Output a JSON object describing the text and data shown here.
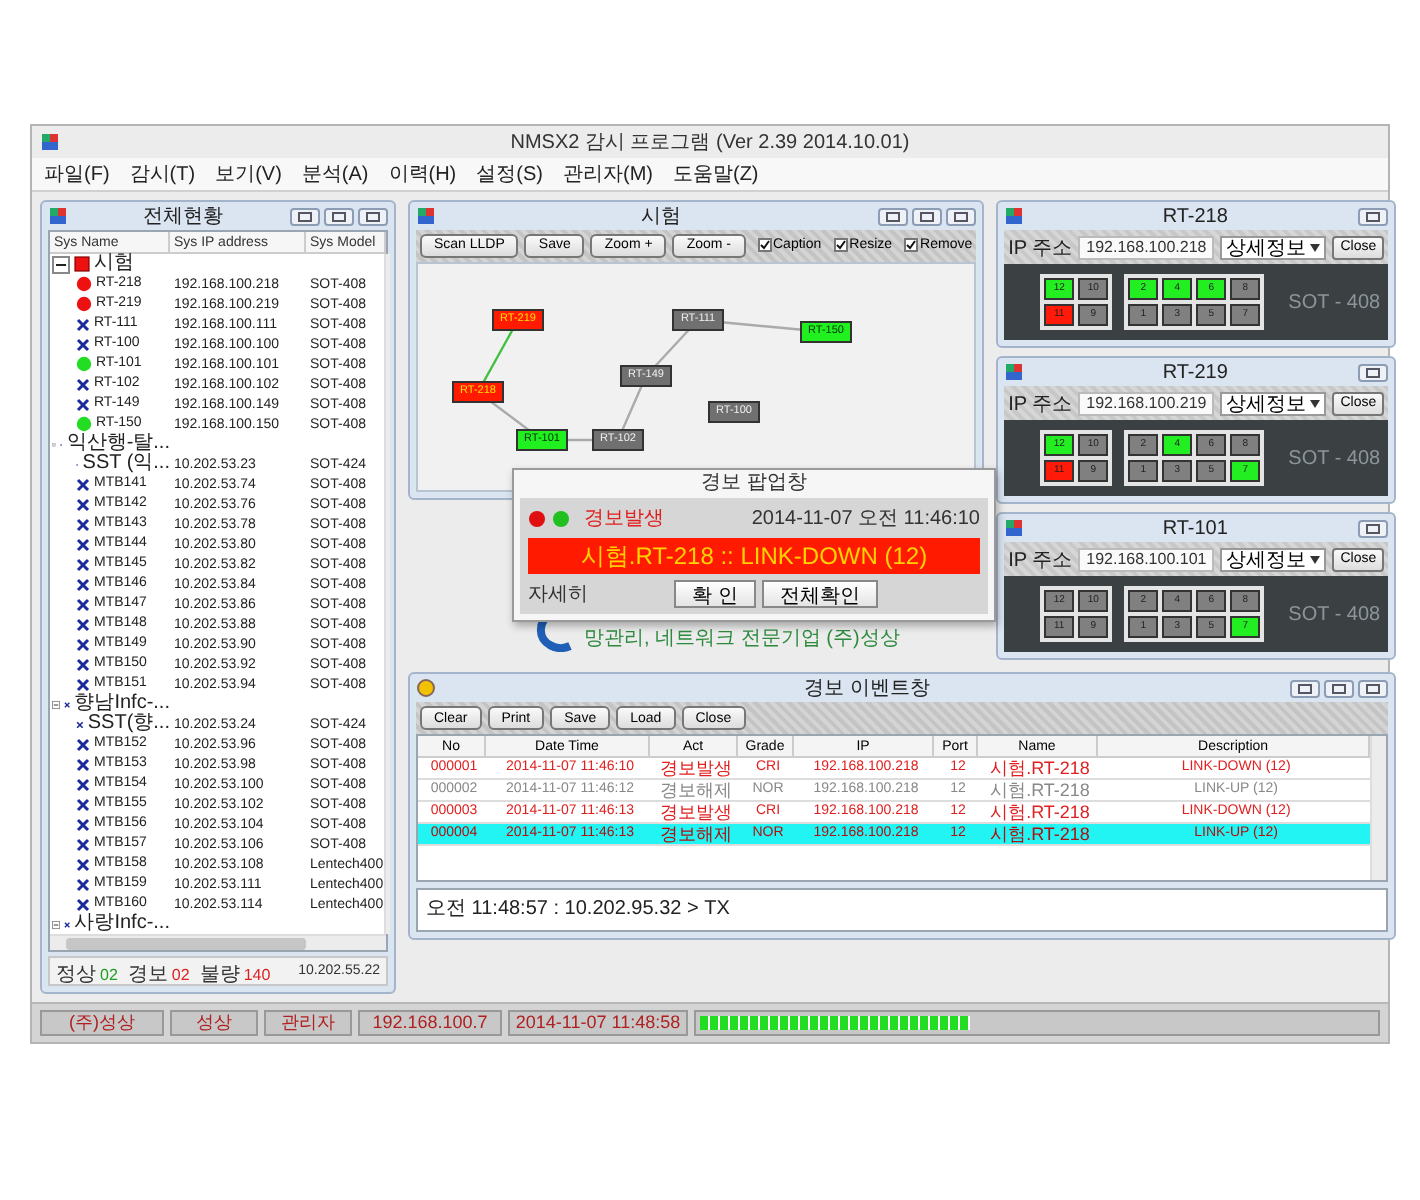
{
  "window": {
    "title": "NMSX2 감시 프로그램 (Ver 2.39  2014.10.01)"
  },
  "menu": [
    "파일(F)",
    "감시(T)",
    "보기(V)",
    "분석(A)",
    "이력(H)",
    "설정(S)",
    "관리자(M)",
    "도움말(Z)"
  ],
  "overview": {
    "title": "전체현황",
    "columns": [
      "Sys Name",
      "Sys IP address",
      "Sys Model"
    ],
    "groups": [
      {
        "name": "시험",
        "kind": "alarm",
        "expanded": true,
        "children": [
          {
            "name": "RT-218",
            "ip": "192.168.100.218",
            "model": "SOT-408",
            "kind": "alarm"
          },
          {
            "name": "RT-219",
            "ip": "192.168.100.219",
            "model": "SOT-408",
            "kind": "alarm"
          },
          {
            "name": "RT-111",
            "ip": "192.168.100.111",
            "model": "SOT-408",
            "kind": "unknown"
          },
          {
            "name": "RT-100",
            "ip": "192.168.100.100",
            "model": "SOT-408",
            "kind": "unknown"
          },
          {
            "name": "RT-101",
            "ip": "192.168.100.101",
            "model": "SOT-408",
            "kind": "normal"
          },
          {
            "name": "RT-102",
            "ip": "192.168.100.102",
            "model": "SOT-408",
            "kind": "unknown"
          },
          {
            "name": "RT-149",
            "ip": "192.168.100.149",
            "model": "SOT-408",
            "kind": "unknown"
          },
          {
            "name": "RT-150",
            "ip": "192.168.100.150",
            "model": "SOT-408",
            "kind": "normal"
          }
        ]
      },
      {
        "name": "익산행-탈...",
        "kind": "unknown",
        "expanded": true,
        "children": [
          {
            "name": "SST (익...",
            "ip": "10.202.53.23",
            "model": "SOT-424",
            "kind": "unknown"
          },
          {
            "name": "MTB141",
            "ip": "10.202.53.74",
            "model": "SOT-408",
            "kind": "unknown"
          },
          {
            "name": "MTB142",
            "ip": "10.202.53.76",
            "model": "SOT-408",
            "kind": "unknown"
          },
          {
            "name": "MTB143",
            "ip": "10.202.53.78",
            "model": "SOT-408",
            "kind": "unknown"
          },
          {
            "name": "MTB144",
            "ip": "10.202.53.80",
            "model": "SOT-408",
            "kind": "unknown"
          },
          {
            "name": "MTB145",
            "ip": "10.202.53.82",
            "model": "SOT-408",
            "kind": "unknown"
          },
          {
            "name": "MTB146",
            "ip": "10.202.53.84",
            "model": "SOT-408",
            "kind": "unknown"
          },
          {
            "name": "MTB147",
            "ip": "10.202.53.86",
            "model": "SOT-408",
            "kind": "unknown"
          },
          {
            "name": "MTB148",
            "ip": "10.202.53.88",
            "model": "SOT-408",
            "kind": "unknown"
          },
          {
            "name": "MTB149",
            "ip": "10.202.53.90",
            "model": "SOT-408",
            "kind": "unknown"
          },
          {
            "name": "MTB150",
            "ip": "10.202.53.92",
            "model": "SOT-408",
            "kind": "unknown"
          },
          {
            "name": "MTB151",
            "ip": "10.202.53.94",
            "model": "SOT-408",
            "kind": "unknown"
          }
        ]
      },
      {
        "name": "향남Infc-...",
        "kind": "unknown",
        "expanded": true,
        "children": [
          {
            "name": "SST(향...",
            "ip": "10.202.53.24",
            "model": "SOT-424",
            "kind": "unknown"
          },
          {
            "name": "MTB152",
            "ip": "10.202.53.96",
            "model": "SOT-408",
            "kind": "unknown"
          },
          {
            "name": "MTB153",
            "ip": "10.202.53.98",
            "model": "SOT-408",
            "kind": "unknown"
          },
          {
            "name": "MTB154",
            "ip": "10.202.53.100",
            "model": "SOT-408",
            "kind": "unknown"
          },
          {
            "name": "MTB155",
            "ip": "10.202.53.102",
            "model": "SOT-408",
            "kind": "unknown"
          },
          {
            "name": "MTB156",
            "ip": "10.202.53.104",
            "model": "SOT-408",
            "kind": "unknown"
          },
          {
            "name": "MTB157",
            "ip": "10.202.53.106",
            "model": "SOT-408",
            "kind": "unknown"
          },
          {
            "name": "MTB158",
            "ip": "10.202.53.108",
            "model": "Lentech400",
            "kind": "unknown"
          },
          {
            "name": "MTB159",
            "ip": "10.202.53.111",
            "model": "Lentech400",
            "kind": "unknown"
          },
          {
            "name": "MTB160",
            "ip": "10.202.53.114",
            "model": "Lentech400",
            "kind": "unknown"
          }
        ]
      },
      {
        "name": "사랑Infc-...",
        "kind": "unknown",
        "expanded": true
      }
    ],
    "summary": [
      {
        "label": "정상",
        "count": "02",
        "color": "#20a020"
      },
      {
        "label": "경보",
        "count": "02",
        "color": "#e02020"
      },
      {
        "label": "불량",
        "count": "140",
        "color": "#e02020"
      }
    ],
    "address": "10.202.55.22"
  },
  "topology": {
    "title": "시험",
    "buttons": [
      "Scan LLDP",
      "Save",
      "Zoom +",
      "Zoom -"
    ],
    "options": [
      {
        "label": "Caption",
        "checked": true
      },
      {
        "label": "Resize",
        "checked": true
      },
      {
        "label": "Remove",
        "checked": true
      }
    ],
    "nodes": [
      {
        "label": "RT-219",
        "kind": "alarm"
      },
      {
        "label": "RT-218",
        "kind": "alarm"
      },
      {
        "label": "RT-101",
        "kind": "normal"
      },
      {
        "label": "RT-102",
        "kind": "unknown"
      },
      {
        "label": "RT-149",
        "kind": "unknown"
      },
      {
        "label": "RT-111",
        "kind": "unknown"
      },
      {
        "label": "RT-150",
        "kind": "normal"
      },
      {
        "label": "RT-100",
        "kind": "unknown"
      }
    ]
  },
  "alarm_popup": {
    "title": "경보 팝업창",
    "label": "경보발생",
    "time": "2014-11-07 오전 11:46:10",
    "message": "시험.RT-218 :: LINK-DOWN (12)",
    "detail": "자세히",
    "buttons": [
      "확 인",
      "전체확인"
    ]
  },
  "logo_text": "망관리, 네트워크 전문기업 (주)성상",
  "devices": [
    {
      "title": "RT-218",
      "ip_label": "IP 주소",
      "ip": "192.168.100.218",
      "detail": "상세정보",
      "close": "Close",
      "model": "SOT - 408",
      "ports": [
        {
          "label": "12",
          "kind": "up"
        },
        {
          "label": "10",
          "kind": "off"
        },
        {
          "label": "2",
          "kind": "up"
        },
        {
          "label": "4",
          "kind": "up"
        },
        {
          "label": "6",
          "kind": "up"
        },
        {
          "label": "8",
          "kind": "off"
        },
        {
          "label": "11",
          "kind": "down"
        },
        {
          "label": "9",
          "kind": "off"
        },
        {
          "label": "1",
          "kind": "off"
        },
        {
          "label": "3",
          "kind": "off"
        },
        {
          "label": "5",
          "kind": "off"
        },
        {
          "label": "7",
          "kind": "off"
        }
      ]
    },
    {
      "title": "RT-219",
      "ip_label": "IP 주소",
      "ip": "192.168.100.219",
      "detail": "상세정보",
      "close": "Close",
      "model": "SOT - 408",
      "ports": [
        {
          "label": "12",
          "kind": "up"
        },
        {
          "label": "10",
          "kind": "off"
        },
        {
          "label": "2",
          "kind": "off"
        },
        {
          "label": "4",
          "kind": "up"
        },
        {
          "label": "6",
          "kind": "off"
        },
        {
          "label": "8",
          "kind": "off"
        },
        {
          "label": "11",
          "kind": "down"
        },
        {
          "label": "9",
          "kind": "off"
        },
        {
          "label": "1",
          "kind": "off"
        },
        {
          "label": "3",
          "kind": "off"
        },
        {
          "label": "5",
          "kind": "off"
        },
        {
          "label": "7",
          "kind": "up"
        }
      ]
    },
    {
      "title": "RT-101",
      "ip_label": "IP 주소",
      "ip": "192.168.100.101",
      "detail": "상세정보",
      "close": "Close",
      "model": "SOT - 408",
      "ports": [
        {
          "label": "12",
          "kind": "off"
        },
        {
          "label": "10",
          "kind": "off"
        },
        {
          "label": "2",
          "kind": "off"
        },
        {
          "label": "4",
          "kind": "off"
        },
        {
          "label": "6",
          "kind": "off"
        },
        {
          "label": "8",
          "kind": "off"
        },
        {
          "label": "11",
          "kind": "off"
        },
        {
          "label": "9",
          "kind": "off"
        },
        {
          "label": "1",
          "kind": "off"
        },
        {
          "label": "3",
          "kind": "off"
        },
        {
          "label": "5",
          "kind": "off"
        },
        {
          "label": "7",
          "kind": "up"
        }
      ]
    }
  ],
  "events": {
    "title": "경보 이벤트창",
    "buttons": [
      "Clear",
      "Print",
      "Save",
      "Load",
      "Close"
    ],
    "columns": [
      "No",
      "Date Time",
      "Act",
      "Grade",
      "IP",
      "Port",
      "Name",
      "Description"
    ],
    "rows": [
      {
        "kind": "alarm",
        "selected": false,
        "cells": [
          "000001",
          "2014-11-07 11:46:10",
          "경보발생",
          "CRI",
          "192.168.100.218",
          "12",
          "시험.RT-218",
          "LINK-DOWN (12)"
        ]
      },
      {
        "kind": "clear",
        "selected": false,
        "cells": [
          "000002",
          "2014-11-07 11:46:12",
          "경보해제",
          "NOR",
          "192.168.100.218",
          "12",
          "시험.RT-218",
          "LINK-UP (12)"
        ]
      },
      {
        "kind": "alarm",
        "selected": false,
        "cells": [
          "000003",
          "2014-11-07 11:46:13",
          "경보발생",
          "CRI",
          "192.168.100.218",
          "12",
          "시험.RT-218",
          "LINK-DOWN (12)"
        ]
      },
      {
        "kind": "clear",
        "selected": true,
        "cells": [
          "000004",
          "2014-11-07 11:46:13",
          "경보해제",
          "NOR",
          "192.168.100.218",
          "12",
          "시험.RT-218",
          "LINK-UP (12)"
        ]
      }
    ],
    "log": "오전 11:48:57 : 10.202.95.32 > TX"
  },
  "status_bar": {
    "items": [
      "(주)성상",
      "성상",
      "관리자",
      "192.168.100.7",
      "2014-11-07 11:48:58"
    ],
    "level": 0.4
  }
}
